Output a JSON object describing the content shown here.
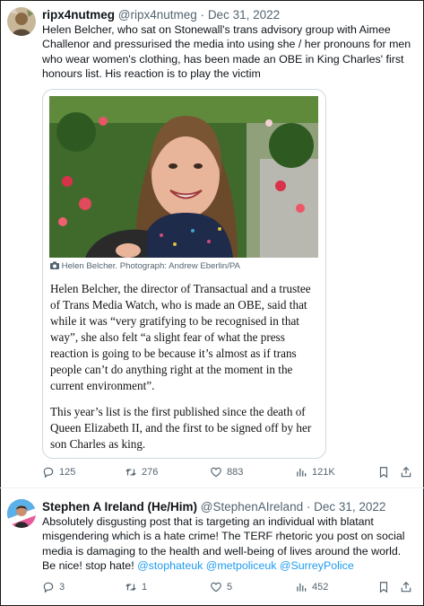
{
  "tweets": [
    {
      "display_name": "ripx4nutmeg",
      "handle": "@ripx4nutmeg",
      "separator": "·",
      "date": "Dec 31, 2022",
      "text": "Helen Belcher, who sat on Stonewall's trans advisory group with Aimee Challenor and pressurised the media into using she / her pronouns for men who wear women's clothing, has been made an OBE in King Charles' first honours list. His reaction is to play the victim",
      "card": {
        "caption": "Helen Belcher. Photograph: Andrew Eberlin/PA",
        "paragraph_1": "Helen Belcher, the director of Transactual and a trustee of Trans Media Watch, who is made an OBE, said that while it was “very gratifying to be recognised in that way”, she also felt “a slight fear of what the press reaction is going to be because it’s almost as if trans people can’t do anything right at the moment in the current environment”.",
        "paragraph_2": "This year’s list is the first published since the death of Queen Elizabeth II, and the first to be signed off by her son Charles as king."
      },
      "metrics": {
        "replies": "125",
        "retweets": "276",
        "likes": "883",
        "views": "121K"
      }
    },
    {
      "display_name": "Stephen A Ireland (He/Him)",
      "handle": "@StephenAIreland",
      "separator": "·",
      "date": "Dec 31, 2022",
      "text": "Absolutely disgusting post that is targeting an individual with blatant misgendering which is a hate crime! The TERF rhetoric you post on social media is damaging to the health and well-being of lives around the world. Be nice! stop hate!",
      "mentions": [
        "@stophateuk",
        "@metpoliceuk",
        "@SurreyPolice"
      ],
      "metrics": {
        "replies": "3",
        "retweets": "1",
        "likes": "5",
        "views": "452"
      }
    }
  ],
  "colors": {
    "text": "#0f1419",
    "secondary": "#536471",
    "link": "#1d9bf0",
    "border": "#cfd9de"
  },
  "icons": [
    "reply-icon",
    "retweet-icon",
    "like-icon",
    "views-icon",
    "bookmark-icon",
    "share-icon",
    "camera-icon"
  ]
}
